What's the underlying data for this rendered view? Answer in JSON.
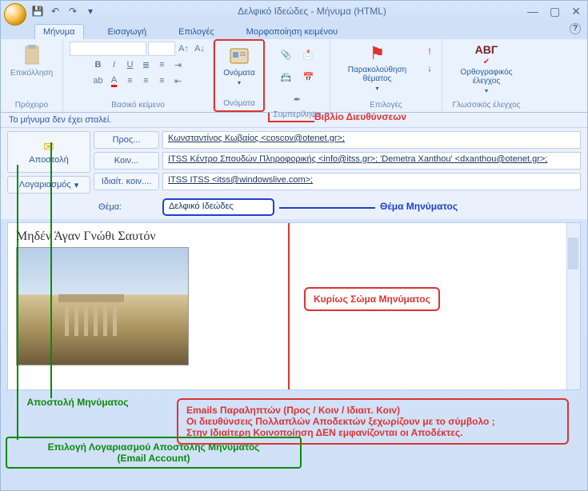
{
  "window": {
    "title": "Δελφικό Ιδεώδες - Μήνυμα (HTML)"
  },
  "tabs": {
    "message": "Μήνυμα",
    "insert": "Εισαγωγή",
    "options": "Επιλογές",
    "format": "Μορφοποίηση κειμένου"
  },
  "ribbon": {
    "clipboard": {
      "paste": "Επικόλληση",
      "group": "Πρόχειρο"
    },
    "font": {
      "group": "Βασικό κείμενο"
    },
    "names": {
      "btn": "Ονόματα",
      "group": "Ονόματα"
    },
    "include": {
      "group": "Συμπερίληψη"
    },
    "followup": {
      "btn": "Παρακολούθηση θέματος",
      "group": "Επιλογές"
    },
    "proof": {
      "btn": "Ορθογραφικός έλεγχος",
      "abv": "ΑΒΓ",
      "group": "Γλωσσικός έλεγχος"
    }
  },
  "infobar": "Το μήνυμα δεν έχει σταλεί.",
  "compose": {
    "send": "Αποστολή",
    "account": "Λογαριασμός",
    "to_btn": "Προς...",
    "cc_btn": "Κοιν...",
    "bcc_btn": "Ιδιαίτ. κοιν....",
    "to_val": "Κωνσταντίνος Κωβαίος <coscov@otenet.gr>;",
    "cc_val": "ITSS Κέντρο Σπουδών Πληροφορικής <info@itss.gr>; 'Demetra Xanthou' <dxanthou@otenet.gr>;",
    "bcc_val": "ITSS ITSS <itss@windowslive.com>;",
    "subject_lbl": "Θέμα:",
    "subject_val": "Δελφικό Ιδεώδες"
  },
  "body": {
    "heading": "Μηδέν Άγαν Γνώθι Σαυτόν"
  },
  "callouts": {
    "addressbook": "Βιβλίο Διευθύνσεων",
    "subject": "Θέμα Μηνύματος",
    "body": "Κυρίως Σώμα Μηνύματος",
    "send": "Αποστολή Μηνύματος",
    "account": "Επιλογή Λογαριασμού Αποστολής Μηνύματος\n(Email Account)",
    "recipients_l1": "Emails Παραληπτών (Προς / Κοιν / Ιδιαιτ. Κοιν)",
    "recipients_l2": "Οι διευθύνσεις Πολλαπλών Αποδεκτών ξεχωρίζουν με το σύμβολο ;",
    "recipients_l3": "Στην Ιδιαίτερη Κοινοποίηση ΔΕΝ εμφανίζονται οι Αποδέκτες."
  }
}
